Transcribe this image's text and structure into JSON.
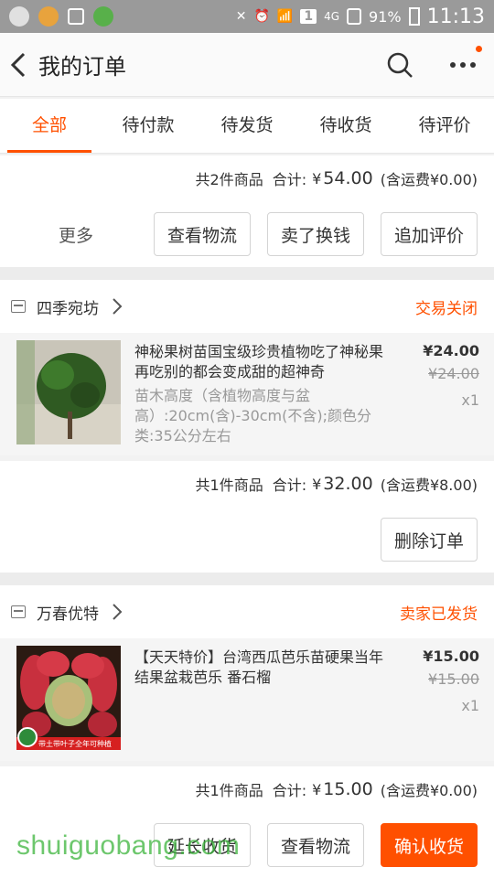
{
  "status_bar": {
    "battery_pct": "91%",
    "time": "11:13",
    "sim": "1",
    "network": "4G"
  },
  "nav": {
    "title": "我的订单",
    "back_icon": "back-chevron-icon",
    "search_icon": "search-icon",
    "more_icon": "more-dots-icon"
  },
  "tabs": [
    "全部",
    "待付款",
    "待发货",
    "待收货",
    "待评价"
  ],
  "active_tab": 0,
  "order0": {
    "summary": {
      "count": "共2件商品",
      "total_label": "合计:",
      "total_cur": "¥",
      "total_amount": "54.00",
      "shipping": "(含运费¥0.00)"
    },
    "more_label": "更多",
    "buttons": [
      "查看物流",
      "卖了换钱",
      "追加评价"
    ]
  },
  "order1": {
    "shop": "四季宛坊",
    "status": "交易关闭",
    "item": {
      "title": "神秘果树苗国宝级珍贵植物吃了神秘果再吃别的都会变成甜的超神奇",
      "sku": "苗木高度（含植物高度与盆高）:20cm(含)-30cm(不含);颜色分类:35公分左右",
      "price": "¥24.00",
      "original_price": "¥24.00",
      "qty": "x1"
    },
    "summary": {
      "count": "共1件商品",
      "total_label": "合计:",
      "total_cur": "¥",
      "total_amount": "32.00",
      "shipping": "(含运费¥8.00)"
    },
    "buttons": [
      "删除订单"
    ]
  },
  "order2": {
    "shop": "万春优特",
    "status": "卖家已发货",
    "item": {
      "title": "【天天特价】台湾西瓜芭乐苗硬果当年结果盆栽芭乐 番石榴",
      "price": "¥15.00",
      "original_price": "¥15.00",
      "qty": "x1",
      "image_caption": "带土带叶子全年可种植"
    },
    "summary": {
      "count": "共1件商品",
      "total_label": "合计:",
      "total_cur": "¥",
      "total_amount": "15.00",
      "shipping": "(含运费¥0.00)"
    },
    "buttons": [
      "延长收货",
      "查看物流",
      "确认收货"
    ]
  },
  "watermark": "shuiguobang.com",
  "colors": {
    "accent": "#ff5000",
    "status_bar": "#9a9a9a"
  }
}
